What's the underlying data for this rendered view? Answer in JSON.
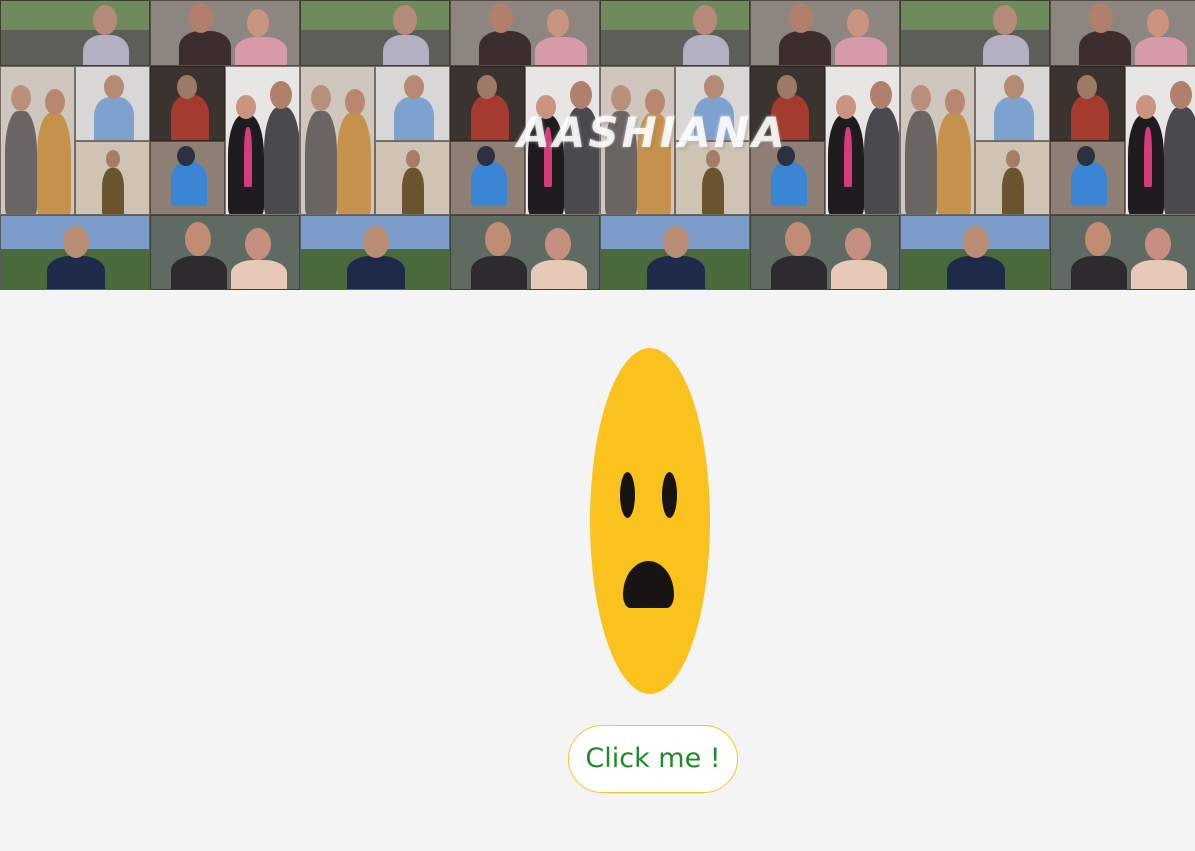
{
  "header": {
    "logo_text": "AASHIANA"
  },
  "face": {
    "color": "#fbc11d",
    "feature_color": "#161513",
    "expression": "sad"
  },
  "button": {
    "label": "Click me !",
    "text_color": "#1f8a2a",
    "border_color": "#f3c52e"
  },
  "colors": {
    "page_background": "#f4f4f4"
  }
}
